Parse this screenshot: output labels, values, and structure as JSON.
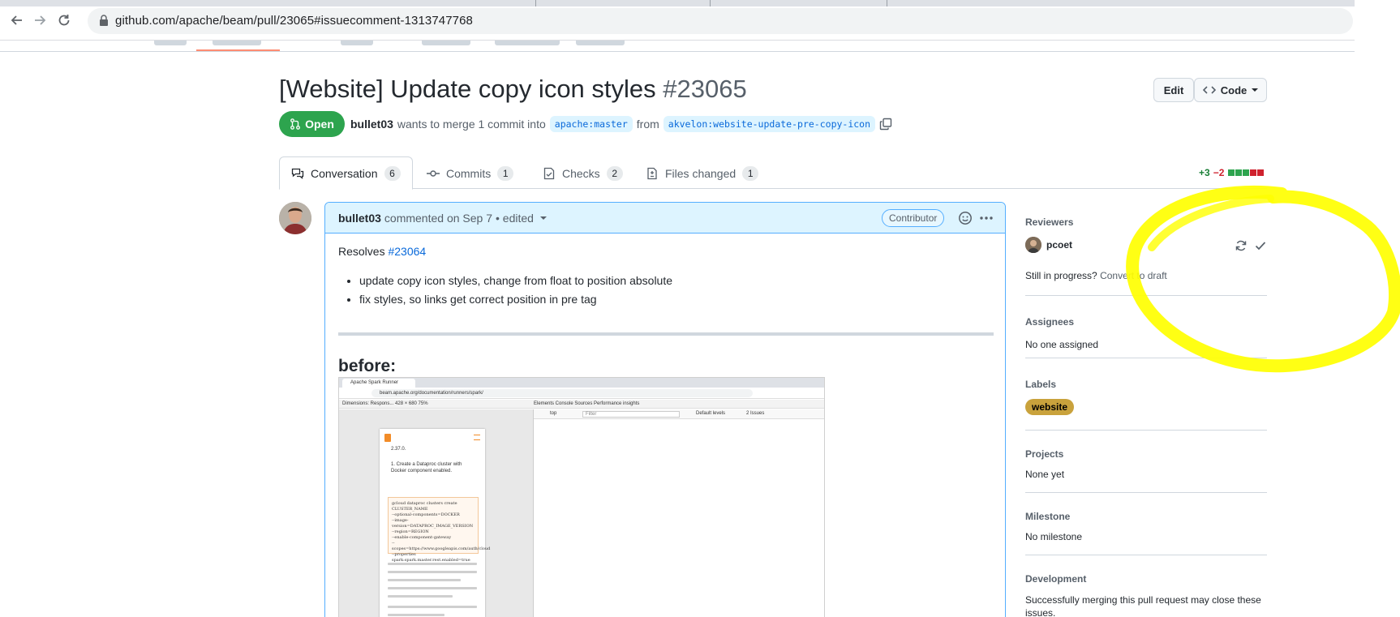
{
  "browser": {
    "url": "github.com/apache/beam/pull/23065#issuecomment-1313747768"
  },
  "pr": {
    "title": "[Website] Update copy icon styles",
    "number": "#23065",
    "state": "Open",
    "author": "bullet03",
    "merge_text": "wants to merge 1 commit into",
    "base_branch": "apache:master",
    "from_text": "from",
    "head_branch": "akvelon:website-update-pre-copy-icon",
    "edit_label": "Edit",
    "code_label": "Code"
  },
  "tabs": [
    {
      "label": "Conversation",
      "count": "6"
    },
    {
      "label": "Commits",
      "count": "1"
    },
    {
      "label": "Checks",
      "count": "2"
    },
    {
      "label": "Files changed",
      "count": "1"
    }
  ],
  "diffstat": {
    "additions": "+3",
    "deletions": "−2",
    "colors": [
      "#2da44e",
      "#2da44e",
      "#2da44e",
      "#cf222e",
      "#cf222e"
    ]
  },
  "comment": {
    "author": "bullet03",
    "commented_text": "commented on Sep 7",
    "edited_text": "• edited",
    "role_badge": "Contributor",
    "resolves_text": "Resolves",
    "resolves_link": "#23064",
    "bullets": [
      "update copy icon styles, change from float to position absolute",
      "fix styles, so links get correct position in pre tag"
    ],
    "before_heading": "before:"
  },
  "embedded_screenshot": {
    "tab_title": "Apache Spark Runner",
    "url": "beam.apache.org/documentation/runners/spark/",
    "devtools_left": "Dimensions: Respons...    428  ×  680     75%",
    "devtools_tabs": "Elements   Console   Sources   Performance insights",
    "console_top": "top",
    "console_filter": "Filter",
    "console_levels": "Default levels",
    "console_issues": "2 Issues",
    "version_text": "2.37.0.",
    "step_text": "1. Create a Dataproc cluster with Docker component enabled.",
    "code_lines": [
      "gcloud dataproc clusters create CLUSTER_NAME",
      "  --optional-components=DOCKER",
      "  --image-version=DATAPROC_IMAGE_VERSION",
      "  --region=REGION",
      "  --enable-component-gateway",
      "  --scopes=https://www.googleapis.com/auth/cloud",
      "  --properties spark:spark.master.rest.enabled=true"
    ]
  },
  "sidebar": {
    "reviewers_title": "Reviewers",
    "reviewer_name": "pcoet",
    "draft_question": "Still in progress?",
    "draft_link": "Convert to draft",
    "assignees_title": "Assignees",
    "assignees_value": "No one assigned",
    "labels_title": "Labels",
    "label_name": "website",
    "projects_title": "Projects",
    "projects_value": "None yet",
    "milestone_title": "Milestone",
    "milestone_value": "No milestone",
    "development_title": "Development",
    "development_value": "Successfully merging this pull request may close these issues."
  },
  "colors": {
    "open_green": "#2da44e",
    "link_blue": "#0969da",
    "comment_header_bg": "#ddf4ff",
    "label_bg": "#c9a23c",
    "annotation_yellow": "#ffff00"
  }
}
